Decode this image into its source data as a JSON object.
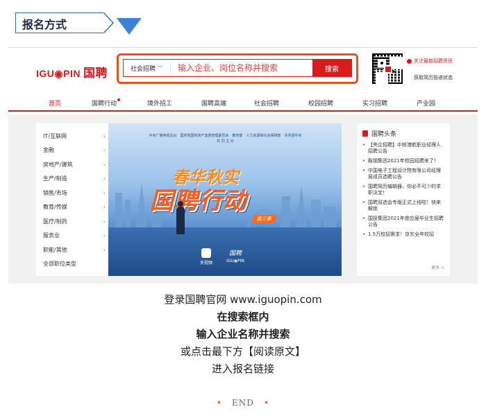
{
  "section": {
    "title": "报名方式"
  },
  "site": {
    "logo_text": "IGU◉PIN",
    "logo_cn": "国聘",
    "search": {
      "category": "社会招聘",
      "placeholder": "输入企业、岗位名称并搜索",
      "button": "搜索"
    },
    "qr_text_1": "关注最新招聘资讯",
    "qr_text_2": "获取简历投递状态",
    "nav": [
      "首页",
      "国聘行动",
      "境外招工",
      "国聘高端",
      "社会招聘",
      "校园招聘",
      "实习招聘",
      "产业园"
    ],
    "categories": [
      "IT/互联网",
      "金融",
      "房地产/建筑",
      "生产/制造",
      "销售/市场",
      "教育/传媒",
      "医疗/制药",
      "服务业",
      "职能/其他",
      "全部职位类型"
    ],
    "banner": {
      "top_line_1": "中央广播电视总台　国务院国有资产监督管理委员会　教育部　人力资源和社会保障部　共青团中央",
      "top_line_2": "共 同 主 办",
      "title_1": "春华秋实",
      "title_2": "国聘行动",
      "season": "第三季",
      "logo_1": "央视频",
      "logo_2_mark": "国聘",
      "logo_2": "IGU◉PIN"
    },
    "news": {
      "heading": "国聘头条",
      "items": [
        "【央企招聘】中核港航职业经理人招聘公告",
        "鞍钢集团2021年校园招聘来了！",
        "中国电子工程设计院有限公司经理层成员选聘公告",
        "国聘简历编辑器，你必不可少的求职法宝！",
        "国聘双选会专版正式上线啦！快来解锁",
        "国投集团2021年度应届毕业生招聘公告",
        "1.5万校招需求！京东全年校招"
      ],
      "more": "更多 >"
    }
  },
  "instructions": {
    "line1": "登录国聘官网 www.iguopin.com",
    "line2": "在搜索框内",
    "line3": "输入企业名称并搜索",
    "line4": "或点击最下方【阅读原文】",
    "line5": "进入报名链接"
  },
  "end": "END",
  "colors": {
    "brand_red": "#d71c1c",
    "highlight_orange": "#e8501e",
    "tag_blue": "#2b6cb0"
  }
}
